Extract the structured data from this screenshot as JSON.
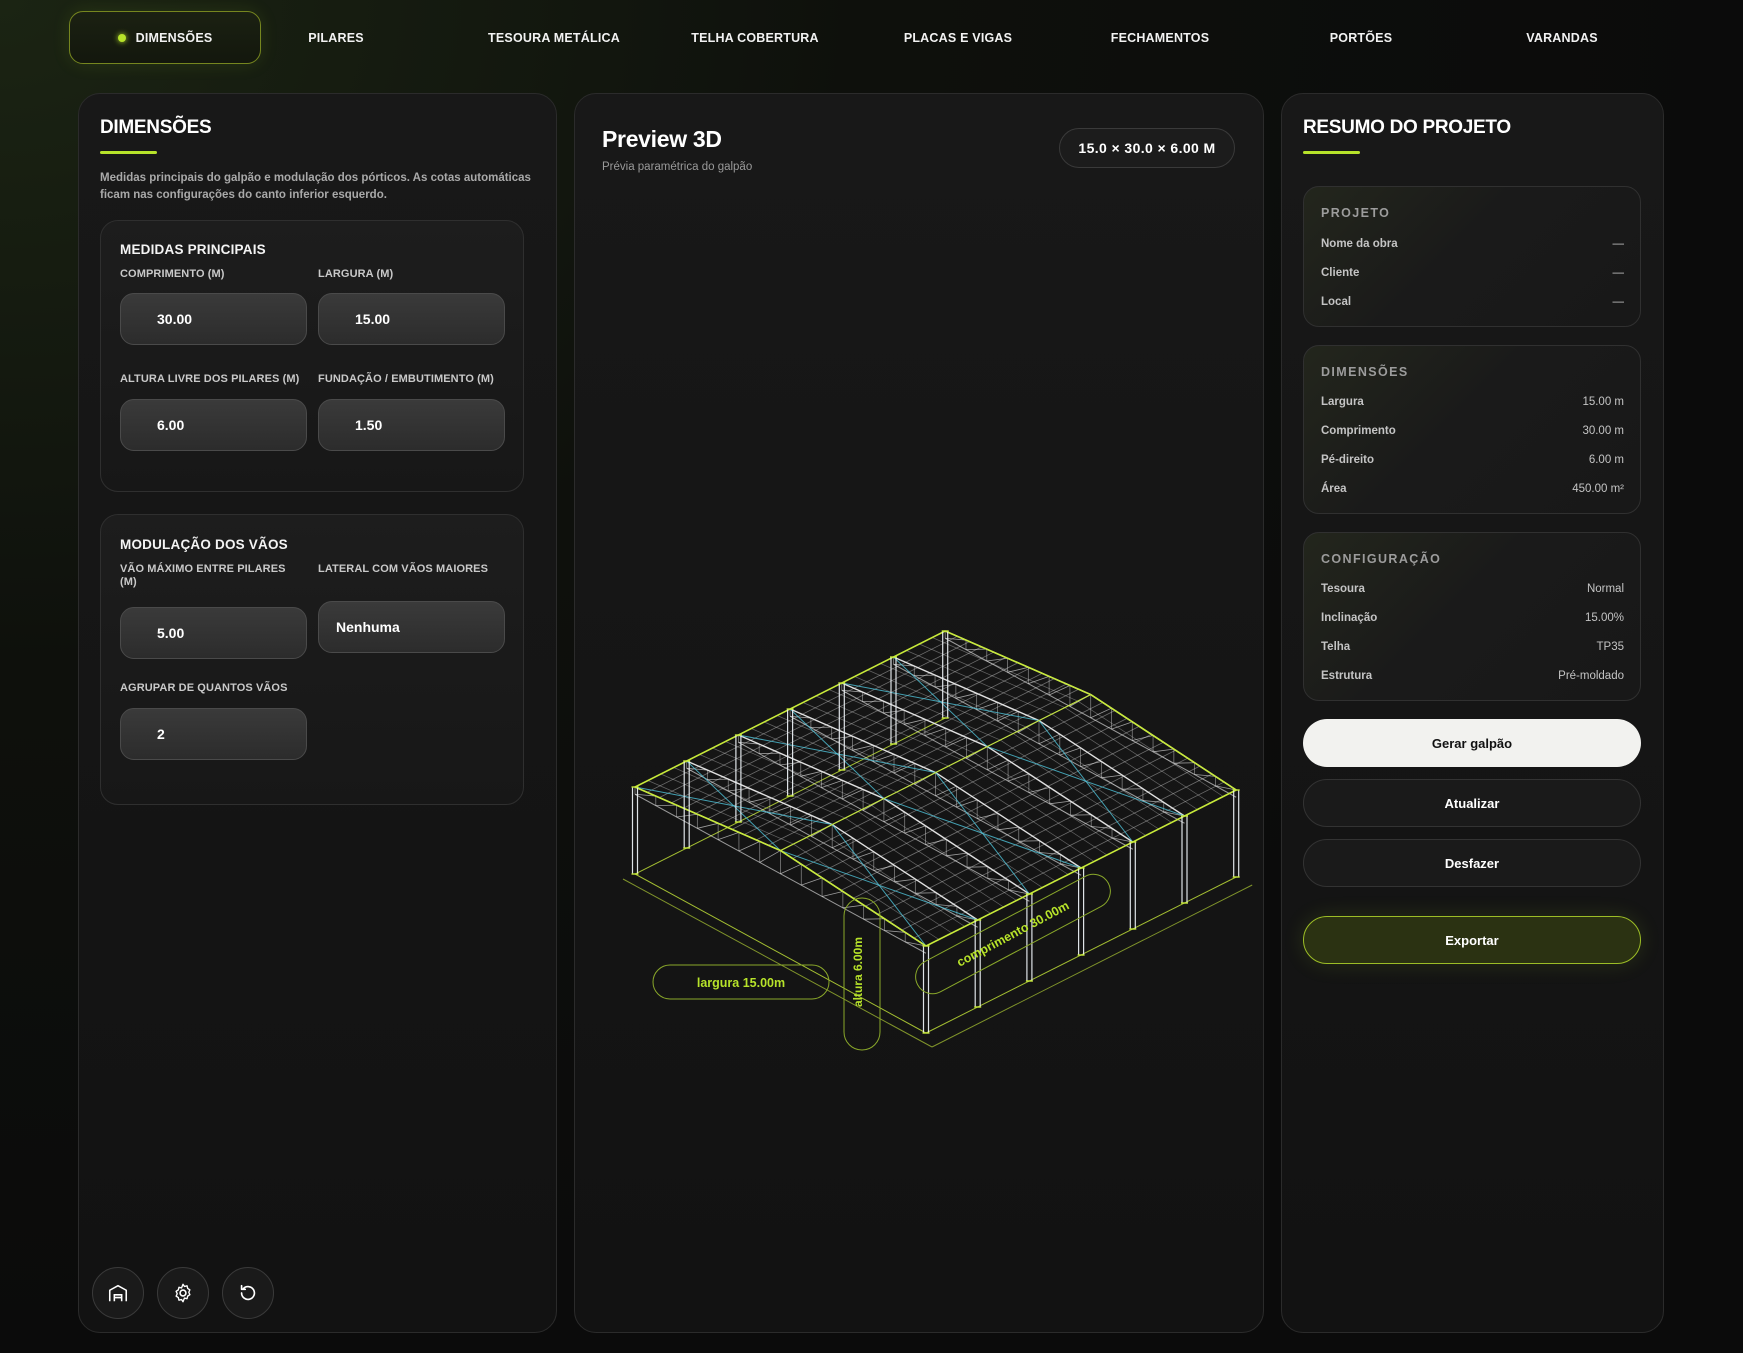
{
  "tabs": [
    {
      "label": "DIMENSÕES",
      "active": true
    },
    {
      "label": "PILARES"
    },
    {
      "label": "TESOURA METÁLICA"
    },
    {
      "label": "TELHA COBERTURA"
    },
    {
      "label": "PLACAS E VIGAS"
    },
    {
      "label": "FECHAMENTOS"
    },
    {
      "label": "PORTÕES"
    },
    {
      "label": "VARANDAS"
    }
  ],
  "left": {
    "title": "DIMENSÕES",
    "description_line1": "Medidas principais do galpão e modulação dos pórticos. As cotas automáticas",
    "description_line2": "ficam nas configurações do canto inferior esquerdo.",
    "main": {
      "title": "MEDIDAS PRINCIPAIS",
      "comprimento_label": "COMPRIMENTO (M)",
      "comprimento_value": "30.00",
      "largura_label": "LARGURA (M)",
      "largura_value": "15.00",
      "altura_label": "ALTURA LIVRE DOS PILARES (M)",
      "altura_value": "6.00",
      "fundacao_label": "FUNDAÇÃO / EMBUTIMENTO (M)",
      "fundacao_value": "1.50"
    },
    "modulation": {
      "title": "MODULAÇÃO DOS VÃOS",
      "vao_label_line1": "VÃO MÁXIMO ENTRE PILARES",
      "vao_label_line2": "(M)",
      "vao_value": "5.00",
      "lateral_label": "LATERAL COM VÃOS MAIORES",
      "lateral_value": "Nenhuma",
      "agrupar_label": "AGRUPAR DE QUANTOS VÃOS",
      "agrupar_value": "2"
    },
    "icons": [
      "building-icon",
      "gear-icon",
      "reset-icon"
    ]
  },
  "preview": {
    "title": "Preview 3D",
    "subtitle": "Prévia paramétrica do galpão",
    "badge": "15.0 × 30.0 × 6.00 M",
    "dim_largura": "largura 15.00m",
    "dim_altura": "altura 6.00m",
    "dim_comprimento": "comprimento 30.00m"
  },
  "summary": {
    "title": "RESUMO DO PROJETO",
    "projeto": {
      "heading": "PROJETO",
      "rows": [
        {
          "k": "Nome da obra",
          "v": "—"
        },
        {
          "k": "Cliente",
          "v": "—"
        },
        {
          "k": "Local",
          "v": "—"
        }
      ]
    },
    "dimensoes": {
      "heading": "DIMENSÕES",
      "rows": [
        {
          "k": "Largura",
          "v": "15.00 m"
        },
        {
          "k": "Comprimento",
          "v": "30.00 m"
        },
        {
          "k": "Pé-direito",
          "v": "6.00 m"
        },
        {
          "k": "Área",
          "v": "450.00 m²"
        }
      ]
    },
    "config": {
      "heading": "CONFIGURAÇÃO",
      "rows": [
        {
          "k": "Tesoura",
          "v": "Normal"
        },
        {
          "k": "Inclinação",
          "v": "15.00%"
        },
        {
          "k": "Telha",
          "v": "TP35"
        },
        {
          "k": "Estrutura",
          "v": "Pré-moldado"
        }
      ]
    },
    "buttons": {
      "gerar": "Gerar galpão",
      "atualizar": "Atualizar",
      "desfazer": "Desfazer",
      "exportar": "Exportar"
    }
  },
  "colors": {
    "accent": "#b7e32a",
    "frame": "#c8ea3a",
    "bracing": "#4fc3d9",
    "column": "#e9eef2"
  }
}
